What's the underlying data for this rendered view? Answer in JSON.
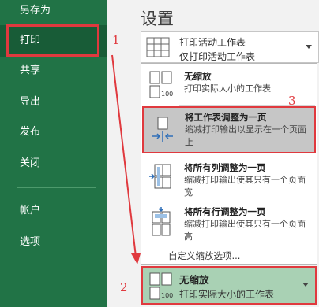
{
  "sidebar": {
    "items": [
      {
        "label": "另存为"
      },
      {
        "label": "打印"
      },
      {
        "label": "共享"
      },
      {
        "label": "导出"
      },
      {
        "label": "发布"
      },
      {
        "label": "关闭"
      },
      {
        "label": "帐户"
      },
      {
        "label": "选项"
      }
    ]
  },
  "annotations": {
    "step1": "1",
    "step2": "2",
    "step3": "3",
    "accent_color": "#e0393e"
  },
  "settings": {
    "title": "设置",
    "print_what": {
      "main": "打印活动工作表",
      "sub": "仅打印活动工作表"
    },
    "scaling_options": [
      {
        "title": "无缩放",
        "desc": "打印实际大小的工作表",
        "icon": "page-100-icon"
      },
      {
        "title": "将工作表调整为一页",
        "desc": "缩减打印输出以显示在一个页面上",
        "icon": "fit-sheet-icon"
      },
      {
        "title": "将所有列调整为一页",
        "desc": "缩减打印输出使其只有一个页面宽",
        "icon": "fit-columns-icon"
      },
      {
        "title": "将所有行调整为一页",
        "desc": "缩减打印输出使其只有一个页面高",
        "icon": "fit-rows-icon"
      }
    ],
    "custom_scaling": "自定义缩放选项...",
    "current_scaling": {
      "main": "无缩放",
      "sub": "打印实际大小的工作表"
    }
  },
  "colors": {
    "sidebar": "#217346",
    "selected_bottom": "#a9d1b4"
  }
}
